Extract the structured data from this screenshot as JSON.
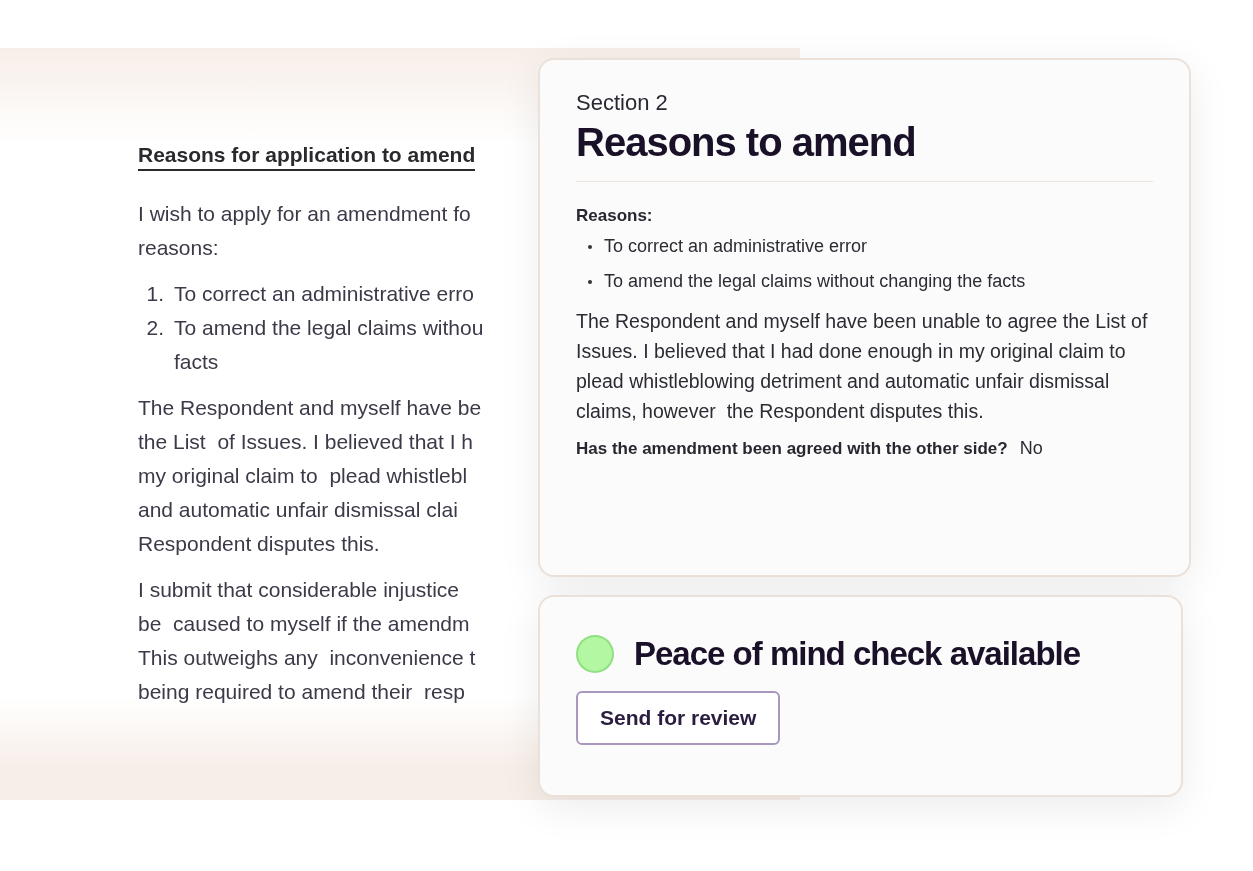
{
  "document": {
    "heading": "Reasons for application to amend",
    "blocks": [
      {
        "kind": "text",
        "lines": [
          "I wish to apply for an amendment fo",
          "reasons:"
        ]
      },
      {
        "kind": "list",
        "items": [
          {
            "number": "1.",
            "lines": [
              "To correct an administrative erro"
            ]
          },
          {
            "number": "2.",
            "lines": [
              "To amend the legal claims withou",
              "facts"
            ]
          }
        ]
      },
      {
        "kind": "text",
        "lines": [
          "The Respondent and myself have be",
          "the List  of Issues. I believed that I h",
          "my original claim to  plead whistlebl",
          "and automatic unfair dismissal clai",
          "Respondent disputes this."
        ]
      },
      {
        "kind": "text",
        "lines": [
          "I submit that considerable injustice",
          "be  caused to myself if the amendm",
          "This outweighs any  inconvenience t",
          "being required to amend their  resp"
        ]
      }
    ]
  },
  "review_card": {
    "section": "Section 2",
    "title": "Reasons to amend",
    "reasons_label": "Reasons:",
    "reasons": [
      "To correct an administrative error",
      "To amend the legal claims without changing the facts"
    ],
    "statement": "The Respondent and myself have been unable to agree the List of Issues. I believed that I had done enough in my original claim to plead whistleblowing detriment and automatic unfair dismissal claims, however  the Respondent disputes this.",
    "question": {
      "label": "Has the amendment been agreed with the other side?",
      "answer": "No"
    }
  },
  "check_card": {
    "status": {
      "label": "Peace of mind check available",
      "color": "#b3f7a3"
    },
    "button": "Send for review"
  }
}
